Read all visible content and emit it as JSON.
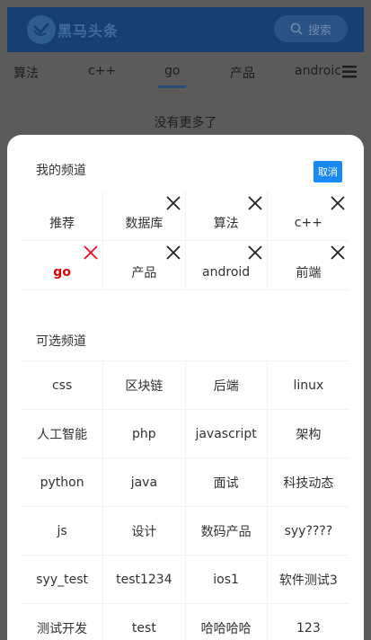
{
  "header": {
    "app_name": "黑马头条",
    "search_label": "搜索"
  },
  "tabs": [
    "算法",
    "c++",
    "go",
    "产品",
    "androic"
  ],
  "no_more_text": "没有更多了",
  "sheet": {
    "my_channels_title": "我的频道",
    "cancel_label": "取消",
    "my_channels": [
      {
        "label": "推荐",
        "removable": false,
        "active": false
      },
      {
        "label": "数据库",
        "removable": true,
        "active": false
      },
      {
        "label": "算法",
        "removable": true,
        "active": false
      },
      {
        "label": "c++",
        "removable": true,
        "active": false
      },
      {
        "label": "go",
        "removable": true,
        "active": true
      },
      {
        "label": "产品",
        "removable": true,
        "active": false
      },
      {
        "label": "android",
        "removable": true,
        "active": false
      },
      {
        "label": "前端",
        "removable": true,
        "active": false
      }
    ],
    "optional_title": "可选频道",
    "optional_channels": [
      "css",
      "区块链",
      "后端",
      "linux",
      "人工智能",
      "php",
      "javascript",
      "架构",
      "python",
      "java",
      "面试",
      "科技动态",
      "js",
      "设计",
      "数码产品",
      "syy????",
      "syy_test",
      "test1234",
      "ios1",
      "软件测试3",
      "测试开发",
      "test",
      "哈哈哈哈",
      "123"
    ]
  },
  "colors": {
    "header_bg": "#173f73",
    "accent_blue": "#1989fa",
    "active_red": "#e00000",
    "close_red": "#ee0a24"
  },
  "icons": {
    "logo": "toutiao-logo-icon",
    "search": "search-icon",
    "menu": "hamburger-menu-icon",
    "remove": "close-icon"
  }
}
